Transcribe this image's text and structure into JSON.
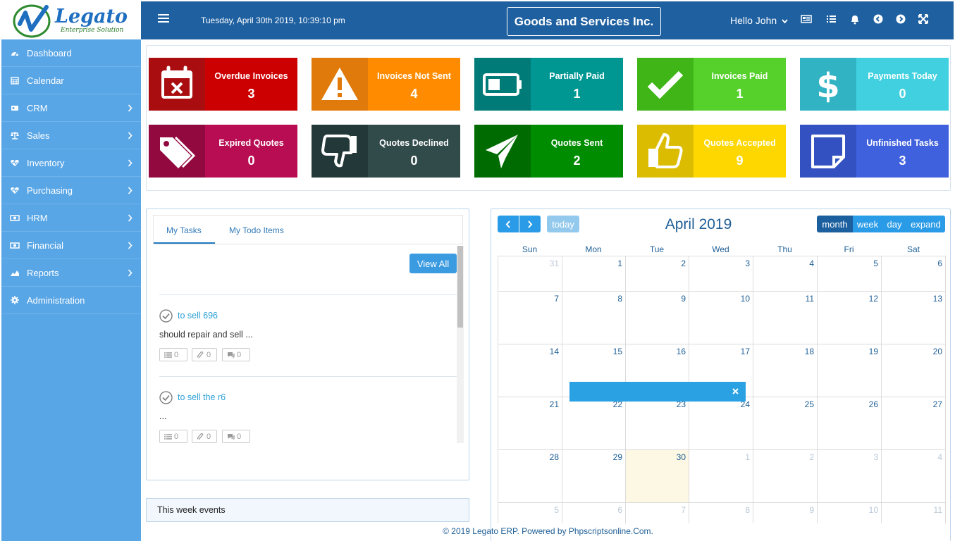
{
  "brand": {
    "name": "Legato",
    "tagline": "Enterprise Solution"
  },
  "header": {
    "datetime": "Tuesday, April 30th 2019, 10:39:10 pm",
    "company": "Goods and Services Inc.",
    "greeting": "Hello John"
  },
  "sidebar": {
    "items": [
      {
        "label": "Dashboard",
        "icon": "dashboard-icon"
      },
      {
        "label": "Calendar",
        "icon": "calendar-icon"
      },
      {
        "label": "CRM",
        "icon": "crm-icon"
      },
      {
        "label": "Sales",
        "icon": "balance-scale-icon"
      },
      {
        "label": "Inventory",
        "icon": "heartbeat-icon"
      },
      {
        "label": "Purchasing",
        "icon": "heartbeat-icon"
      },
      {
        "label": "HRM",
        "icon": "money-icon"
      },
      {
        "label": "Financial",
        "icon": "money-icon"
      },
      {
        "label": "Reports",
        "icon": "area-chart-icon"
      },
      {
        "label": "Administration",
        "icon": "cog-icon"
      }
    ]
  },
  "stats": [
    {
      "label": "Overdue Invoices",
      "value": "3",
      "icon": "calendar-times-icon",
      "color_icon": "#a90d10",
      "color_text": "#cc0000"
    },
    {
      "label": "Invoices Not Sent",
      "value": "4",
      "icon": "warning-icon",
      "color_icon": "#e07a0b",
      "color_text": "#ff8c00"
    },
    {
      "label": "Partially Paid",
      "value": "1",
      "icon": "battery-icon",
      "color_icon": "#007b78",
      "color_text": "#009793"
    },
    {
      "label": "Invoices Paid",
      "value": "1",
      "icon": "check-icon",
      "color_icon": "#3fb517",
      "color_text": "#56d12b"
    },
    {
      "label": "Payments Today",
      "value": "0",
      "icon": "dollar-icon",
      "color_icon": "#31b3c3",
      "color_text": "#40d0df"
    },
    {
      "label": "Expired Quotes",
      "value": "0",
      "icon": "tags-icon",
      "color_icon": "#92093f",
      "color_text": "#b80d53"
    },
    {
      "label": "Quotes Declined",
      "value": "0",
      "icon": "thumbs-down-icon",
      "color_icon": "#233838",
      "color_text": "#314a4a"
    },
    {
      "label": "Quotes Sent",
      "value": "2",
      "icon": "paper-plane-icon",
      "color_icon": "#006b00",
      "color_text": "#008c00"
    },
    {
      "label": "Quotes Accepted",
      "value": "9",
      "icon": "thumbs-up-icon",
      "color_icon": "#dbbc00",
      "color_text": "#fed700"
    },
    {
      "label": "Unfinished Tasks",
      "value": "3",
      "icon": "sticky-note-icon",
      "color_icon": "#3351c0",
      "color_text": "#4061dd"
    }
  ],
  "tasks_panel": {
    "tabs": [
      "My Tasks",
      "My Todo Items"
    ],
    "view_all": "View All",
    "tasks": [
      {
        "title": "to sell 696",
        "desc": "should repair and sell ...",
        "counts": [
          "0",
          "0",
          "0"
        ]
      },
      {
        "title": "to sell the r6",
        "desc": "...",
        "counts": [
          "0",
          "0",
          "0"
        ]
      }
    ]
  },
  "events_panel": {
    "title": "This week events"
  },
  "calendar": {
    "title": "April 2019",
    "today_label": "today",
    "views": [
      "month",
      "week",
      "day",
      "expand"
    ],
    "dow": [
      "Sun",
      "Mon",
      "Tue",
      "Wed",
      "Thu",
      "Fri",
      "Sat"
    ],
    "weeks": [
      [
        "31",
        "1",
        "2",
        "3",
        "4",
        "5",
        "6"
      ],
      [
        "7",
        "8",
        "9",
        "10",
        "11",
        "12",
        "13"
      ],
      [
        "14",
        "15",
        "16",
        "17",
        "18",
        "19",
        "20"
      ],
      [
        "21",
        "22",
        "23",
        "24",
        "25",
        "26",
        "27"
      ],
      [
        "28",
        "29",
        "30",
        "1",
        "2",
        "3",
        "4"
      ],
      [
        "5",
        "6",
        "7",
        "8",
        "9",
        "10",
        "11"
      ]
    ],
    "other_month": [
      [
        0,
        0
      ],
      [
        4,
        3
      ],
      [
        4,
        4
      ],
      [
        4,
        5
      ],
      [
        4,
        6
      ],
      [
        5,
        0
      ],
      [
        5,
        1
      ],
      [
        5,
        2
      ],
      [
        5,
        3
      ],
      [
        5,
        4
      ],
      [
        5,
        5
      ],
      [
        5,
        6
      ]
    ],
    "today": [
      4,
      2
    ]
  },
  "footer": "© 2019 Legato ERP. Powered by Phpscriptsonline.Com."
}
